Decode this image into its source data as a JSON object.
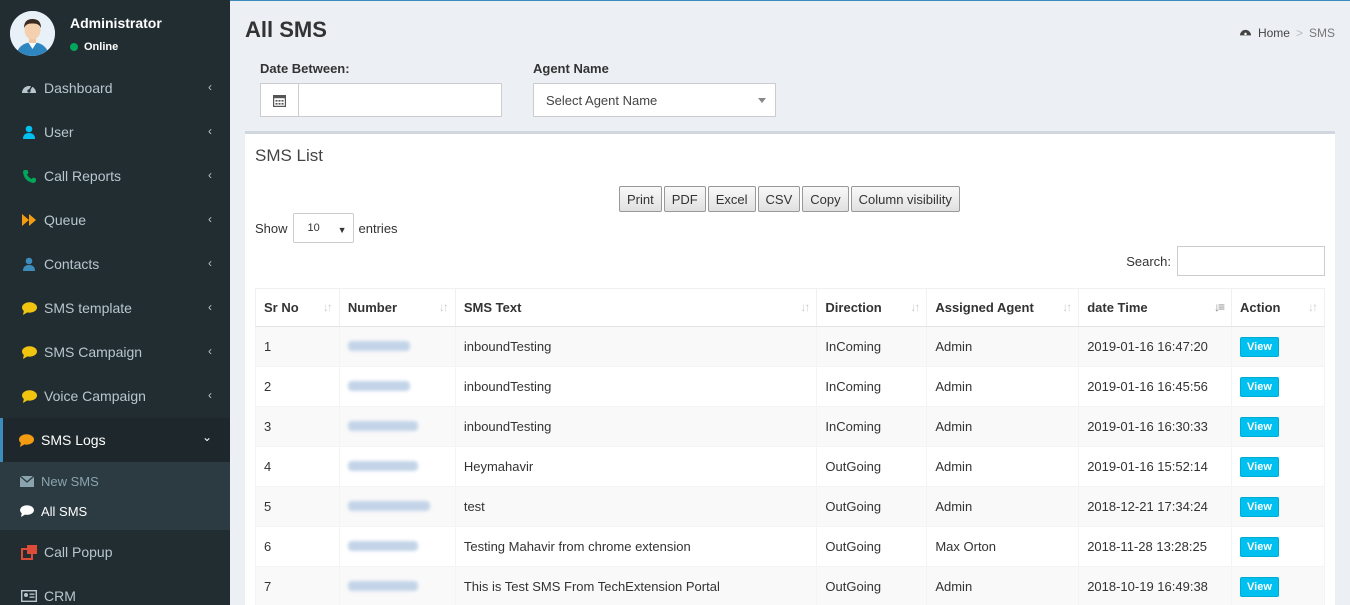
{
  "user": {
    "name": "Administrator",
    "status": "Online"
  },
  "menu": [
    {
      "label": "Dashboard",
      "icon": "dashboard-icon",
      "color": "#b8c7ce"
    },
    {
      "label": "User",
      "icon": "user-icon",
      "color": "#00c0ef"
    },
    {
      "label": "Call Reports",
      "icon": "phone-icon",
      "color": "#00a65a"
    },
    {
      "label": "Queue",
      "icon": "fast-forward-icon",
      "color": "#f39c12"
    },
    {
      "label": "Contacts",
      "icon": "user-icon",
      "color": "#3c8dbc"
    },
    {
      "label": "SMS template",
      "icon": "comment-icon",
      "color": "#f1c40f"
    },
    {
      "label": "SMS Campaign",
      "icon": "comment-icon",
      "color": "#f1c40f"
    },
    {
      "label": "Voice Campaign",
      "icon": "comment-icon",
      "color": "#f1c40f"
    },
    {
      "label": "SMS Logs",
      "icon": "comment-icon",
      "color": "#f39c12"
    }
  ],
  "submenu": [
    {
      "label": "New SMS",
      "icon": "envelope-icon"
    },
    {
      "label": "All SMS",
      "icon": "comment-icon"
    }
  ],
  "menu_bottom": [
    {
      "label": "Call Popup",
      "icon": "external-link-icon",
      "color": "#dd4b39"
    },
    {
      "label": "CRM",
      "icon": "id-card-icon",
      "color": "#b8c7ce"
    }
  ],
  "page": {
    "title": "All SMS"
  },
  "breadcrumb": {
    "home": "Home",
    "current": "SMS"
  },
  "filters": {
    "date_label": "Date Between:",
    "date_value": "",
    "agent_label": "Agent Name",
    "agent_selected": "Select Agent Name"
  },
  "box": {
    "title": "SMS List"
  },
  "buttons": [
    "Print",
    "PDF",
    "Excel",
    "CSV",
    "Copy",
    "Column visibility"
  ],
  "length": {
    "show": "Show",
    "value": "10",
    "entries": "entries"
  },
  "search": {
    "label": "Search:",
    "value": ""
  },
  "table": {
    "headers": [
      "Sr No",
      "Number",
      "SMS Text",
      "Direction",
      "Assigned Agent",
      "date Time",
      "Action"
    ],
    "rows": [
      {
        "sr": "1",
        "text": "inboundTesting",
        "direction": "InComing",
        "agent": "Admin",
        "datetime": "2019-01-16 16:47:20",
        "action": "View"
      },
      {
        "sr": "2",
        "text": "inboundTesting",
        "direction": "InComing",
        "agent": "Admin",
        "datetime": "2019-01-16 16:45:56",
        "action": "View"
      },
      {
        "sr": "3",
        "text": "inboundTesting",
        "direction": "InComing",
        "agent": "Admin",
        "datetime": "2019-01-16 16:30:33",
        "action": "View"
      },
      {
        "sr": "4",
        "text": "Heymahavir",
        "direction": "OutGoing",
        "agent": "Admin",
        "datetime": "2019-01-16 15:52:14",
        "action": "View"
      },
      {
        "sr": "5",
        "text": "test",
        "direction": "OutGoing",
        "agent": "Admin",
        "datetime": "2018-12-21 17:34:24",
        "action": "View"
      },
      {
        "sr": "6",
        "text": "Testing Mahavir from chrome extension",
        "direction": "OutGoing",
        "agent": "Max Orton",
        "datetime": "2018-11-28 13:28:25",
        "action": "View"
      },
      {
        "sr": "7",
        "text": "This is Test SMS From TechExtension Portal",
        "direction": "OutGoing",
        "agent": "Admin",
        "datetime": "2018-10-19 16:49:38",
        "action": "View"
      }
    ]
  }
}
